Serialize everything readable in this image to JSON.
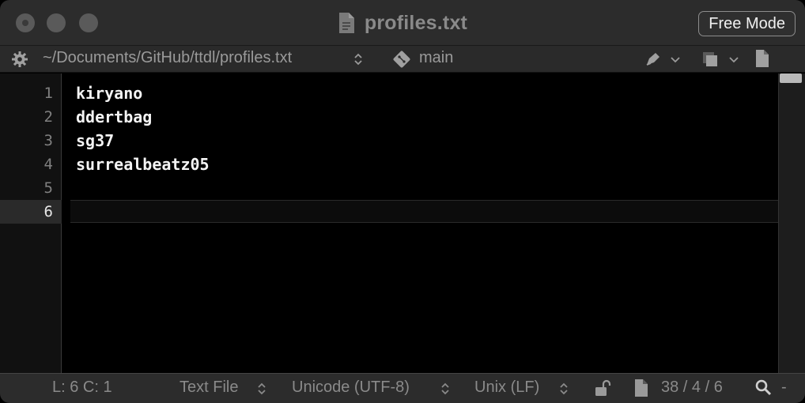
{
  "window": {
    "title": "profiles.txt",
    "mode_button": "Free Mode"
  },
  "pathbar": {
    "path": "~/Documents/GitHub/ttdl/profiles.txt",
    "branch": "main"
  },
  "editor": {
    "line_numbers": [
      "1",
      "2",
      "3",
      "4",
      "5",
      "6"
    ],
    "lines": [
      "kiryano",
      "ddertbag",
      "sg37",
      "surrealbeatz05",
      "",
      ""
    ],
    "current_line": 6
  },
  "statusbar": {
    "position": "L: 6 C: 1",
    "file_type": "Text File",
    "encoding": "Unicode (UTF-8)",
    "line_endings": "Unix (LF)",
    "counts": "38 / 4 / 6",
    "zoom_minus": "-"
  },
  "colors": {
    "titlebar": "#2c2c2c",
    "editor_bg": "#000000",
    "text": "#f4f4f4"
  },
  "icons": [
    "gear-icon",
    "git-branch-icon",
    "pen-icon",
    "layers-icon",
    "page-icon",
    "lock-icon",
    "search-icon"
  ]
}
